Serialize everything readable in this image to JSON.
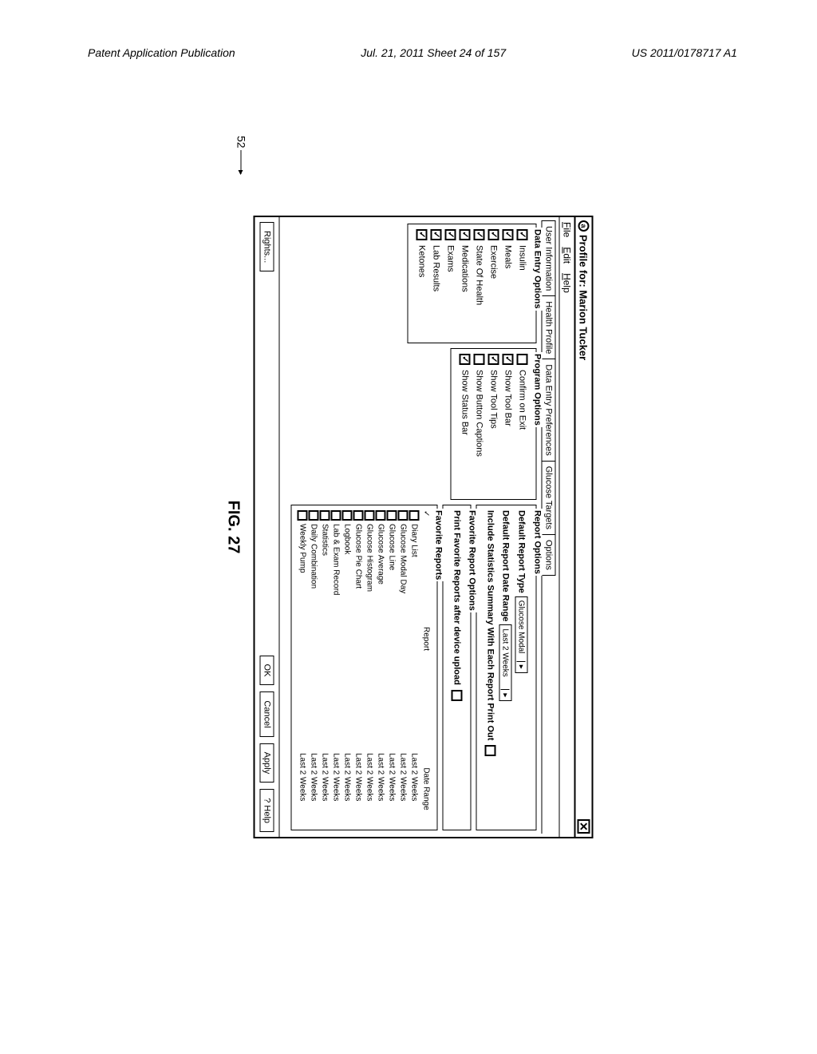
{
  "page_header": {
    "left": "Patent Application Publication",
    "center": "Jul. 21, 2011  Sheet 24 of 157",
    "right": "US 2011/0178717 A1"
  },
  "window": {
    "title": "Profile for: Marion Tucker",
    "menu": {
      "file": "File",
      "edit": "Edit",
      "help": "Help"
    },
    "tabs": [
      "User Information",
      "Health Profile",
      "Data Entry Preferences",
      "Glucose Targets",
      "Options"
    ],
    "active_tab": "Options"
  },
  "data_entry": {
    "title": "Data Entry Options",
    "items": [
      {
        "label": "Insulin",
        "checked": true
      },
      {
        "label": "Meals",
        "checked": true
      },
      {
        "label": "Exercise",
        "checked": true
      },
      {
        "label": "State Of Health",
        "checked": true
      },
      {
        "label": "Medications",
        "checked": true
      },
      {
        "label": "Exams",
        "checked": true
      },
      {
        "label": "Lab Results",
        "checked": true
      },
      {
        "label": "Ketones",
        "checked": true
      }
    ]
  },
  "program_options": {
    "title": "Program Options",
    "items": [
      {
        "label": "Confirm on Exit",
        "checked": false
      },
      {
        "label": "Show Tool Bar",
        "checked": true
      },
      {
        "label": "Show Tool Tips",
        "checked": true
      },
      {
        "label": "Show Button Captions",
        "checked": false
      },
      {
        "label": "Show Status Bar",
        "checked": true
      }
    ]
  },
  "report_options": {
    "title": "Report Options",
    "default_type_label": "Default Report Type",
    "default_type_value": "Glucose Modal",
    "default_range_label": "Default Report Date Range",
    "default_range_value": "Last 2 Weeks",
    "include_stats_label": "Include Statistics Summary With Each Report Print Out",
    "include_stats_checked": false
  },
  "favorite_options": {
    "title": "Favorite Report Options",
    "print_after_upload_label": "Print Favorite Reports after device upload",
    "print_after_upload_checked": false
  },
  "favorite_reports": {
    "title": "Favorite Reports",
    "col_check": "✓",
    "col_report": "Report",
    "col_range": "Date Range",
    "rows": [
      {
        "name": "Diary List",
        "range": "Last 2 Weeks",
        "checked": false
      },
      {
        "name": "Glucose Modal Day",
        "range": "Last 2 Weeks",
        "checked": false
      },
      {
        "name": "Glucose Line",
        "range": "Last 2 Weeks",
        "checked": false
      },
      {
        "name": "Glucose Average",
        "range": "Last 2 Weeks",
        "checked": false
      },
      {
        "name": "Glucose Histogram",
        "range": "Last 2 Weeks",
        "checked": false
      },
      {
        "name": "Glucose Pie Chart",
        "range": "Last 2 Weeks",
        "checked": false
      },
      {
        "name": "Logbook",
        "range": "Last 2 Weeks",
        "checked": false
      },
      {
        "name": "Lab & Exam Record",
        "range": "Last 2 Weeks",
        "checked": false
      },
      {
        "name": "Statistics",
        "range": "Last 2 Weeks",
        "checked": false
      },
      {
        "name": "Daily Combination",
        "range": "Last 2 Weeks",
        "checked": false
      },
      {
        "name": "Weekly Pump",
        "range": "Last 2 Weeks",
        "checked": false
      }
    ]
  },
  "buttons": {
    "rights": "Rights...",
    "ok": "OK",
    "cancel": "Cancel",
    "apply": "Apply",
    "help": "? Help"
  },
  "callout": "52",
  "figure_caption": "FIG. 27"
}
